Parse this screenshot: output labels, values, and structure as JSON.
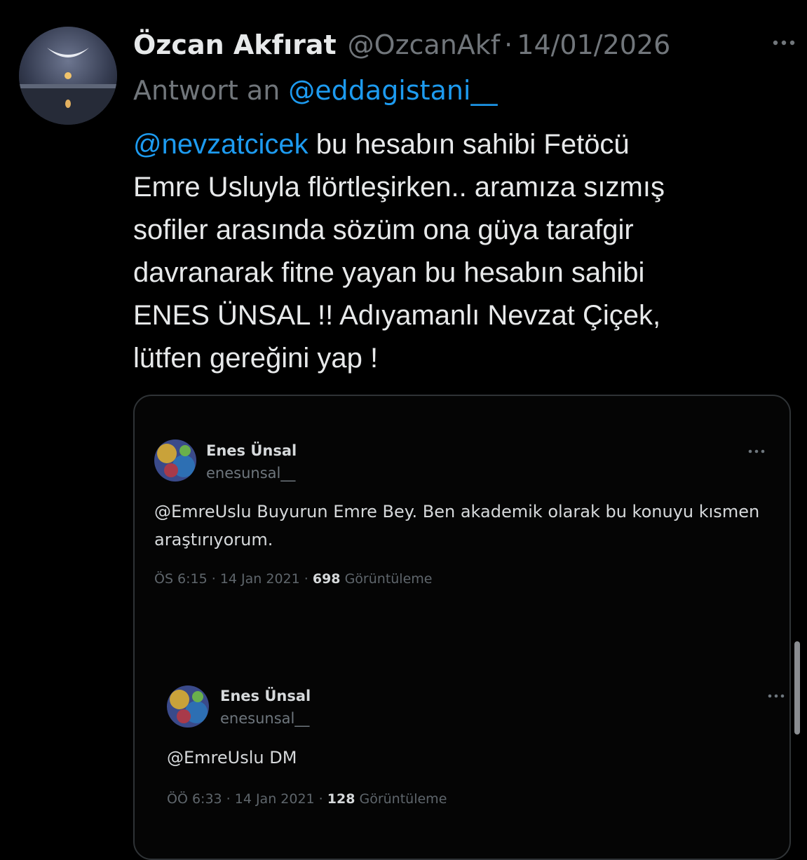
{
  "tweet": {
    "display_name": "Özcan Akfırat",
    "handle": "@OzcanAkf",
    "separator": "·",
    "date": "14/01/2026",
    "reply_prefix": "Antwort an",
    "reply_to": "@eddagistani__",
    "mention": "@nevzatcicek",
    "text_line1_rest": " bu hesabın sahibi Fetöcü",
    "text_line2": "Emre Usluyla flörtleşirken.. aramıza sızmış",
    "text_line3": "sofiler arasında sözüm ona güya tarafgir",
    "text_line4": "davranarak fitne yayan bu hesabın sahibi",
    "text_line5": "ENES ÜNSAL !! Adıyamanlı Nevzat Çiçek,",
    "text_line6": "lütfen gereğini yap !"
  },
  "embedded": [
    {
      "name": "Enes Ünsal",
      "handle": "enesunsal__",
      "text_line1": "@EmreUslu Buyurun Emre Bey. Ben akademik olarak bu konuyu kısmen",
      "text_line2": "araştırıyorum.",
      "time": "ÖS 6:15 · 14 Jan 2021 · ",
      "views": "698",
      "views_label": " Görüntüleme"
    },
    {
      "name": "Enes Ünsal",
      "handle": "enesunsal__",
      "text_line1": "@EmreUslu DM",
      "time": "ÖÖ 6:33 · 14 Jan 2021 · ",
      "views": "128",
      "views_label": " Görüntüleme"
    }
  ],
  "icons": {
    "more": "more-horizontal-icon"
  },
  "colors": {
    "background": "#000000",
    "text": "#e7e9ea",
    "muted": "#71767b",
    "link": "#1d9bf0",
    "card_border": "#2f3336"
  }
}
